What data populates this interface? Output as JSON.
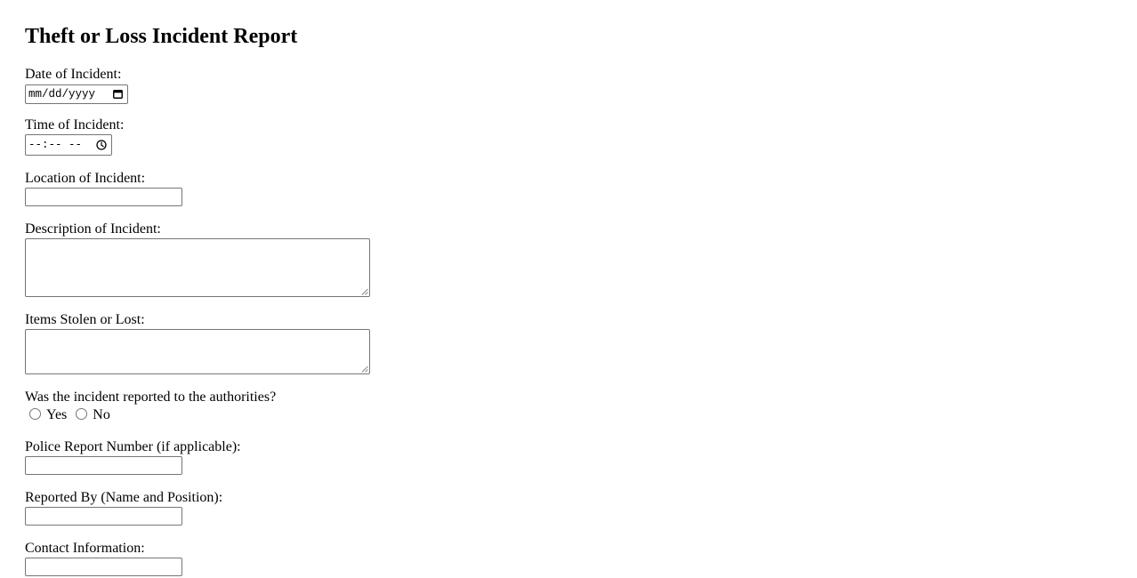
{
  "title": "Theft or Loss Incident Report",
  "form": {
    "date": {
      "label": "Date of Incident:",
      "placeholder": "mm/dd/yyyy"
    },
    "time": {
      "label": "Time of Incident:",
      "placeholder": "--:-- --"
    },
    "location": {
      "label": "Location of Incident:",
      "value": ""
    },
    "description": {
      "label": "Description of Incident:",
      "value": ""
    },
    "items": {
      "label": "Items Stolen or Lost:",
      "value": ""
    },
    "reported": {
      "question": "Was the incident reported to the authorities?",
      "options": [
        "Yes",
        "No"
      ]
    },
    "police_report": {
      "label": "Police Report Number (if applicable):",
      "value": ""
    },
    "reported_by": {
      "label": "Reported By (Name and Position):",
      "value": ""
    },
    "contact": {
      "label": "Contact Information:",
      "value": ""
    }
  },
  "icons": {
    "date": "calendar-icon",
    "time": "clock-icon"
  }
}
